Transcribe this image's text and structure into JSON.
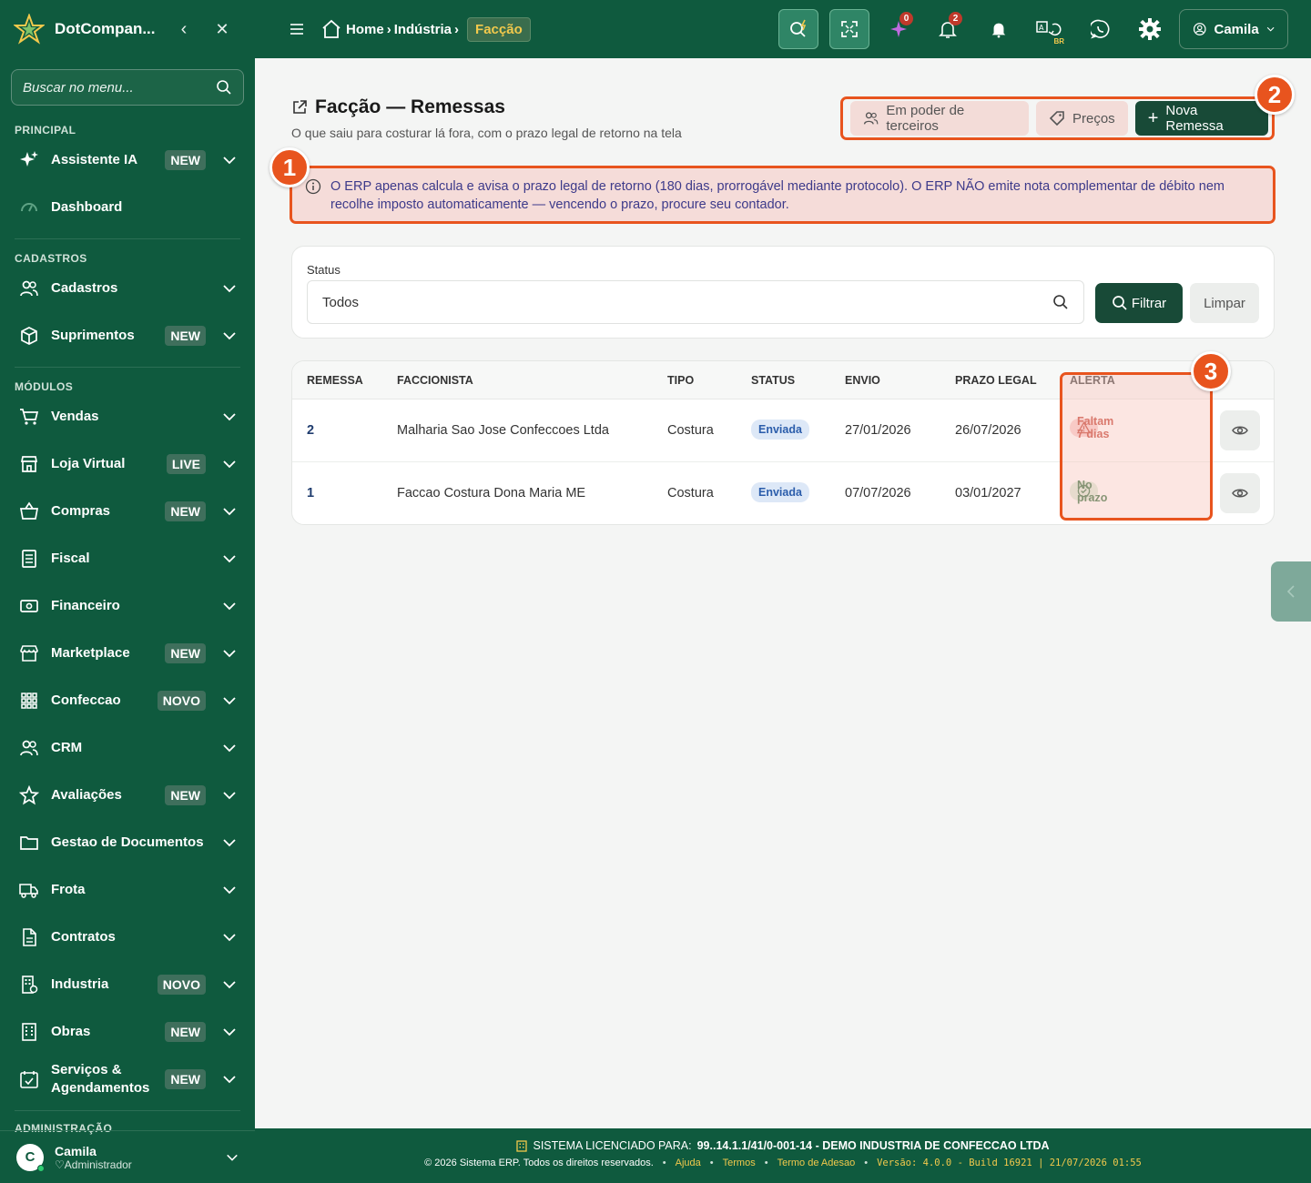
{
  "sidebar": {
    "brand": "DotCompan...",
    "search_placeholder": "Buscar no menu...",
    "sections": {
      "principal": "PRINCIPAL",
      "cadastros": "CADASTROS",
      "modulos": "MÓDULOS",
      "administracao": "ADMINISTRAÇÃO"
    },
    "items": {
      "assistente": {
        "label": "Assistente IA",
        "badge": "NEW"
      },
      "dashboard": {
        "label": "Dashboard"
      },
      "cadastros": {
        "label": "Cadastros"
      },
      "suprimentos": {
        "label": "Suprimentos",
        "badge": "NEW"
      },
      "vendas": {
        "label": "Vendas"
      },
      "loja": {
        "label": "Loja Virtual",
        "badge": "LIVE"
      },
      "compras": {
        "label": "Compras",
        "badge": "NEW"
      },
      "fiscal": {
        "label": "Fiscal"
      },
      "financeiro": {
        "label": "Financeiro"
      },
      "marketplace": {
        "label": "Marketplace",
        "badge": "NEW"
      },
      "confeccao": {
        "label": "Confeccao",
        "badge": "NOVO"
      },
      "crm": {
        "label": "CRM"
      },
      "avaliacoes": {
        "label": "Avaliações",
        "badge": "NEW"
      },
      "documentos": {
        "label": "Gestao de Documentos"
      },
      "frota": {
        "label": "Frota"
      },
      "contratos": {
        "label": "Contratos"
      },
      "industria": {
        "label": "Industria",
        "badge": "NOVO"
      },
      "obras": {
        "label": "Obras",
        "badge": "NEW"
      },
      "servicos": {
        "label": "Serviços & Agendamentos",
        "badge": "NEW"
      }
    },
    "user": {
      "initial": "C",
      "name": "Camila",
      "role": "Administrador"
    }
  },
  "topbar": {
    "breadcrumb": {
      "home": "Home",
      "middle": "Indústria",
      "current": "Facção"
    },
    "badges": {
      "ai": "0",
      "notifications": "2"
    },
    "region": "BR",
    "user": "Camila"
  },
  "page": {
    "title": "Facção — Remessas",
    "subtitle": "O que saiu para costurar lá fora, com o prazo legal de retorno na tela",
    "actions": {
      "third_party": "Em poder de terceiros",
      "prices": "Preços",
      "new": "Nova Remessa"
    },
    "notice": "O ERP apenas calcula e avisa o prazo legal de retorno (180 dias, prorrogável mediante protocolo). O ERP NÃO emite nota complementar de débito nem recolhe imposto automaticamente — vencendo o prazo, procure seu contador.",
    "callouts": {
      "one": "1",
      "two": "2",
      "three": "3"
    }
  },
  "filter": {
    "label": "Status",
    "value": "Todos",
    "filter_btn": "Filtrar",
    "clear_btn": "Limpar"
  },
  "table": {
    "headers": {
      "remessa": "REMESSA",
      "faccionista": "FACCIONISTA",
      "tipo": "TIPO",
      "status": "STATUS",
      "envio": "ENVIO",
      "prazo": "PRAZO LEGAL",
      "alerta": "ALERTA"
    },
    "rows": [
      {
        "remessa": "2",
        "faccionista": "Malharia Sao Jose Confeccoes Ltda",
        "tipo": "Costura",
        "status": "Enviada",
        "envio": "27/01/2026",
        "prazo": "26/07/2026",
        "alerta": "Faltam 7 dias"
      },
      {
        "remessa": "1",
        "faccionista": "Faccao Costura Dona Maria ME",
        "tipo": "Costura",
        "status": "Enviada",
        "envio": "07/07/2026",
        "prazo": "03/01/2027",
        "alerta": "No prazo"
      }
    ]
  },
  "footer": {
    "licensed_label": "SISTEMA LICENCIADO PARA:",
    "licensed_to": "99..14.1.1/41/0-001-14 - DEMO INDUSTRIA DE CONFECCAO LTDA",
    "copyright": "© 2026 Sistema ERP. Todos os direitos reservados.",
    "links": {
      "help": "Ajuda",
      "terms": "Termos",
      "adhesion": "Termo de Adesao"
    },
    "version": "Versão: 4.0.0 - Build 16921 | 21/07/2026 01:55"
  }
}
